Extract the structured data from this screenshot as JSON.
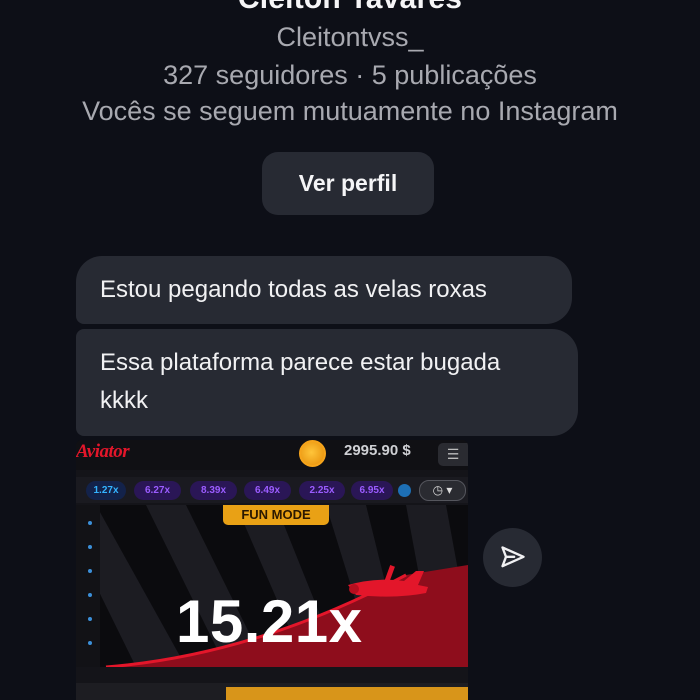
{
  "profile": {
    "name": "Cleiton Tavares",
    "handle": "Cleitontvss_",
    "stats": "327 seguidores · 5 publicações",
    "mutual": "Vocês se seguem mutuamente no Instagram",
    "view_profile_label": "Ver perfil"
  },
  "messages": [
    {
      "text": "Estou pegando todas as velas roxas"
    },
    {
      "text": "Essa plataforma parece estar bugada kkkk"
    }
  ],
  "game_screenshot": {
    "logo": "Aviator",
    "balance": "2995.90 $",
    "multipliers": [
      {
        "value": "1.27x",
        "color": "blue"
      },
      {
        "value": "6.27x",
        "color": "purple"
      },
      {
        "value": "8.39x",
        "color": "purple"
      },
      {
        "value": "6.49x",
        "color": "purple"
      },
      {
        "value": "2.25x",
        "color": "purple"
      },
      {
        "value": "6.95x",
        "color": "purple"
      }
    ],
    "mode_label": "FUN MODE",
    "current_multiplier": "15.21x"
  },
  "icons": {
    "coin": "coin-icon",
    "history": "history-icon",
    "share": "share-paper-plane-icon"
  },
  "colors": {
    "background": "#0d0f17",
    "bubble": "#272a33",
    "aviator_red": "#e3162a",
    "fun_mode": "#e9a115"
  }
}
